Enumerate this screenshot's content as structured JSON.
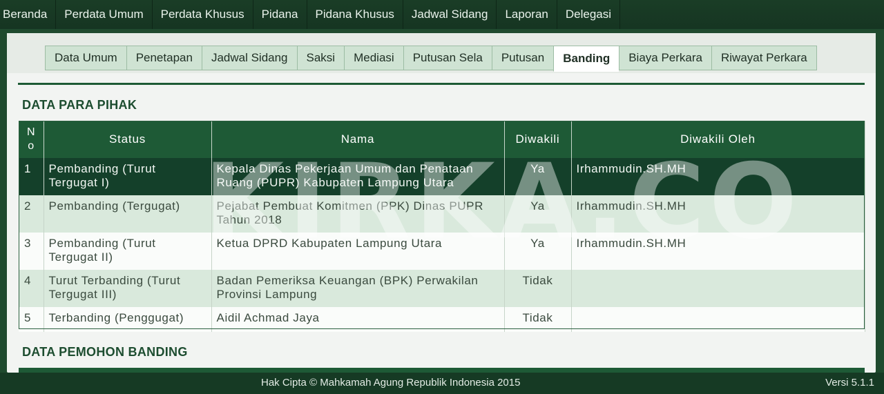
{
  "topnav": [
    "Beranda",
    "Perdata Umum",
    "Perdata Khusus",
    "Pidana",
    "Pidana Khusus",
    "Jadwal Sidang",
    "Laporan",
    "Delegasi"
  ],
  "tabs": [
    "Data Umum",
    "Penetapan",
    "Jadwal Sidang",
    "Saksi",
    "Mediasi",
    "Putusan Sela",
    "Putusan",
    "Banding",
    "Biaya Perkara",
    "Riwayat Perkara"
  ],
  "active_tab": "Banding",
  "section1_title": "DATA PARA PIHAK",
  "section2_title": "DATA PEMOHON BANDING",
  "table": {
    "headers": [
      "No",
      "Status",
      "Nama",
      "Diwakili",
      "Diwakili Oleh"
    ],
    "rows": [
      [
        "1",
        "Pembanding (Turut Tergugat I)",
        "Kepala Dinas Pekerjaan Umum dan Penataan Ruang (PUPR) Kabupaten Lampung Utara",
        "Ya",
        "Irhammudin.SH.MH"
      ],
      [
        "2",
        "Pembanding (Tergugat)",
        "Pejabat Pembuat Komitmen (PPK) Dinas PUPR Tahun 2018",
        "Ya",
        "Irhammudin.SH.MH"
      ],
      [
        "3",
        "Pembanding (Turut Tergugat II)",
        "Ketua DPRD Kabupaten Lampung Utara",
        "Ya",
        "Irhammudin.SH.MH"
      ],
      [
        "4",
        "Turut Terbanding (Turut Tergugat III)",
        "Badan Pemeriksa Keuangan (BPK) Perwakilan Provinsi Lampung",
        "Tidak",
        ""
      ],
      [
        "5",
        "Terbanding (Penggugat)",
        "Aidil Achmad Jaya",
        "Tidak",
        ""
      ]
    ]
  },
  "watermark": "KIRKA.CO",
  "footer": {
    "copyright": "Hak Cipta © Mahkamah Agung Republik Indonesia 2015",
    "version": "Versi 5.1.1"
  }
}
